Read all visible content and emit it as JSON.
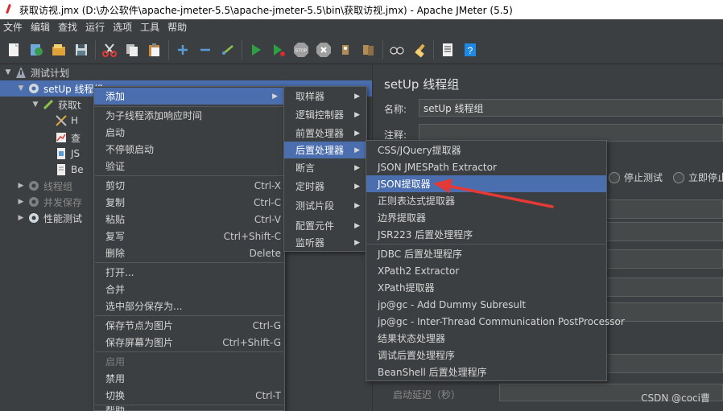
{
  "window": {
    "title": "获取访视.jmx (D:\\办公软件\\apache-jmeter-5.5\\apache-jmeter-5.5\\bin\\获取访视.jmx) - Apache JMeter (5.5)"
  },
  "menubar": [
    "文件",
    "编辑",
    "查找",
    "运行",
    "选项",
    "工具",
    "帮助"
  ],
  "toolbar": {
    "icons": [
      "new-icon",
      "templates-icon",
      "open-icon",
      "save-icon",
      "cut-icon",
      "copy-icon",
      "paste-icon",
      "expand-icon",
      "collapse-icon",
      "toggle-icon",
      "start-icon",
      "start-no-pause-icon",
      "stop-icon",
      "shutdown-icon",
      "clear-icon",
      "clear-all-icon",
      "search-icon",
      "reset-search-icon",
      "function-helper-icon",
      "help-icon"
    ],
    "stop_label": "STOP"
  },
  "tree": {
    "root": "测试计划",
    "setup": "setUp 线程组",
    "child1": "获取t",
    "leaf1": "H",
    "leaf2": "查",
    "leaf3": "JS",
    "leaf4": "Be",
    "thread_group": "线程组",
    "concurrent": "并发保存",
    "perf": "性能测试"
  },
  "right_panel": {
    "title": "setUp 线程组",
    "name_label": "名称:",
    "name_value": "setUp 线程组",
    "comment_label": "注释:",
    "stop_test": "停止测试",
    "stop_now": "立即停止",
    "startup_delay": "启动延迟（秒）"
  },
  "context_menu": {
    "items": [
      {
        "label": "添加",
        "shortcut": "",
        "submenu": true,
        "highlighted": true
      },
      {
        "label": "为子线程添加响应时间",
        "shortcut": ""
      },
      {
        "label": "启动",
        "shortcut": ""
      },
      {
        "label": "不停顿启动",
        "shortcut": ""
      },
      {
        "label": "验证",
        "shortcut": ""
      },
      {
        "label": "剪切",
        "shortcut": "Ctrl-X"
      },
      {
        "label": "复制",
        "shortcut": "Ctrl-C"
      },
      {
        "label": "粘贴",
        "shortcut": "Ctrl-V"
      },
      {
        "label": "复写",
        "shortcut": "Ctrl+Shift-C"
      },
      {
        "label": "删除",
        "shortcut": "Delete"
      },
      {
        "label": "打开...",
        "shortcut": ""
      },
      {
        "label": "合并",
        "shortcut": ""
      },
      {
        "label": "选中部分保存为...",
        "shortcut": ""
      },
      {
        "label": "保存节点为图片",
        "shortcut": "Ctrl-G"
      },
      {
        "label": "保存屏幕为图片",
        "shortcut": "Ctrl+Shift-G"
      },
      {
        "label": "启用",
        "shortcut": "",
        "disabled": true
      },
      {
        "label": "禁用",
        "shortcut": ""
      },
      {
        "label": "切换",
        "shortcut": "Ctrl-T"
      },
      {
        "label": "帮助",
        "shortcut": ""
      }
    ]
  },
  "add_submenu": {
    "items": [
      "取样器",
      "逻辑控制器",
      "前置处理器",
      "后置处理器",
      "断言",
      "定时器",
      "测试片段",
      "配置元件",
      "监听器"
    ],
    "highlighted": "后置处理器"
  },
  "post_processor_submenu": {
    "items": [
      "CSS/JQuery提取器",
      "JSON JMESPath Extractor",
      "JSON提取器",
      "正则表达式提取器",
      "边界提取器",
      "JSR223 后置处理程序",
      "JDBC 后置处理程序",
      "XPath2 Extractor",
      "XPath提取器",
      "jp@gc - Add Dummy Subresult",
      "jp@gc - Inter-Thread Communication PostProcessor",
      "结果状态处理器",
      "调试后置处理程序",
      "BeanShell 后置处理程序"
    ],
    "highlighted": "JSON提取器"
  },
  "watermark": "CSDN @coci曹",
  "colors": {
    "selection": "#4b6eaf",
    "background": "#3c3f41",
    "annotation_arrow": "#e53935"
  }
}
